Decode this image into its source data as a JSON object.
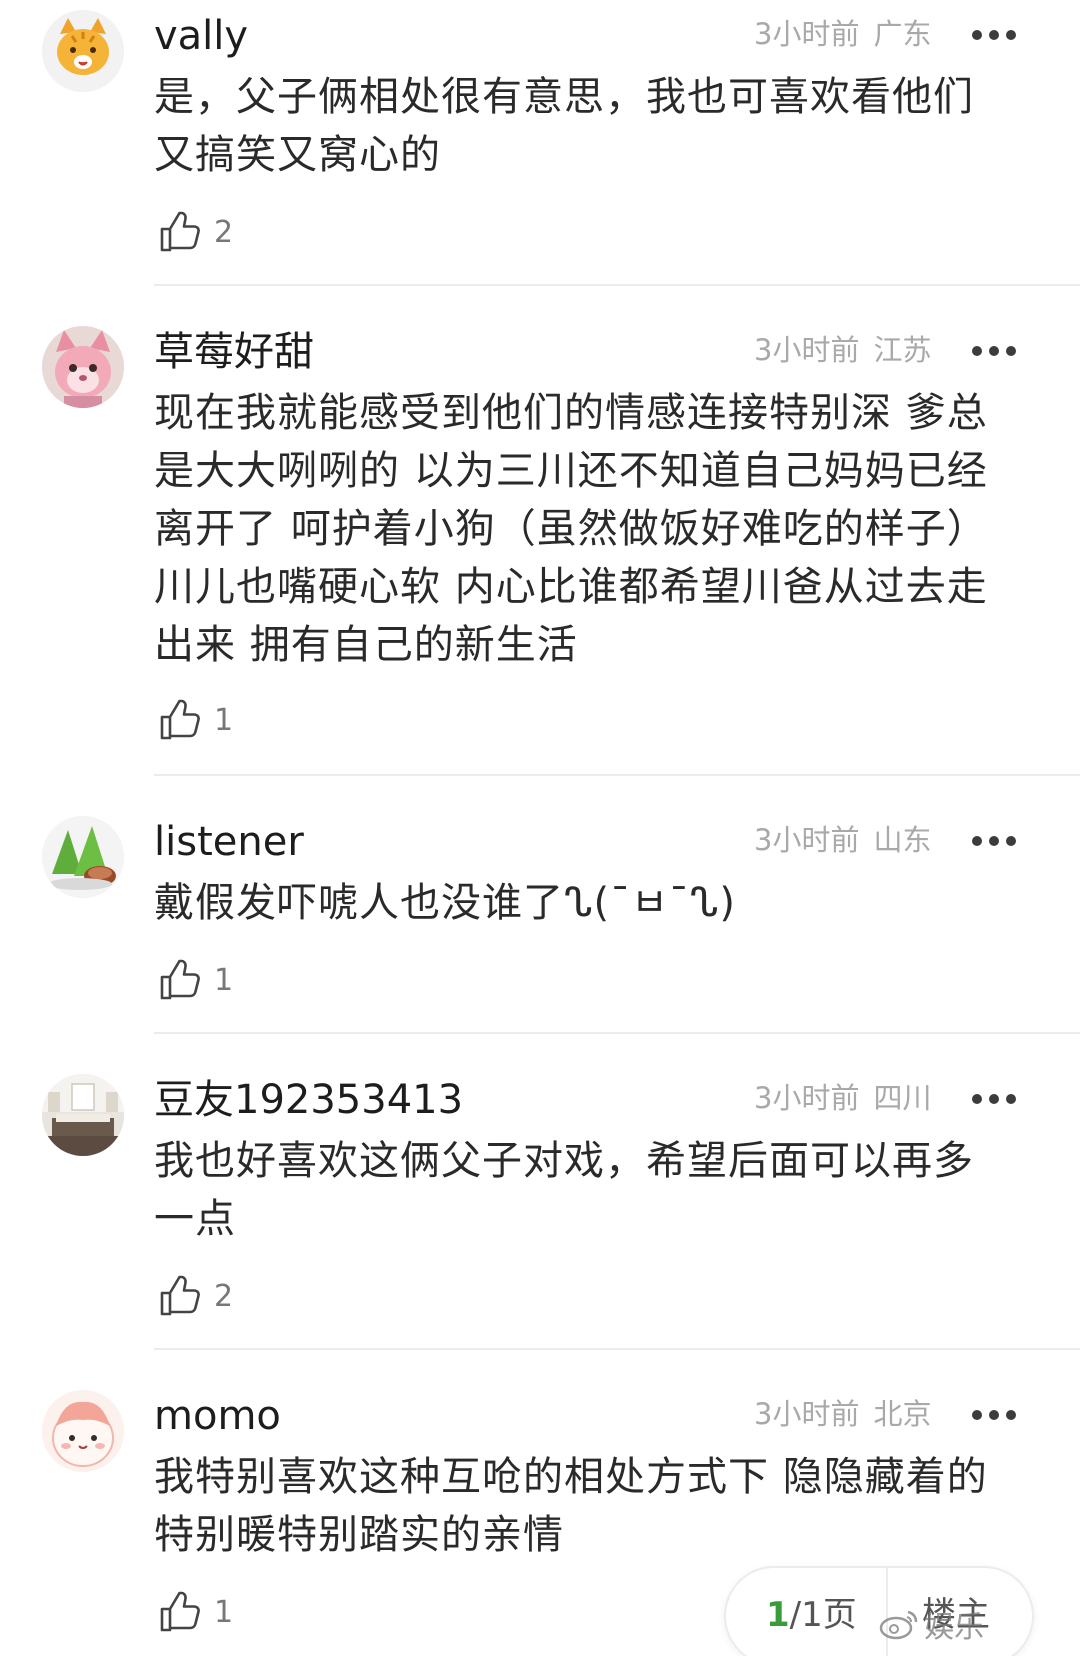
{
  "comments": [
    {
      "username": "vally",
      "time": "3小时前",
      "location": "广东",
      "text": "是，父子俩相处很有意思，我也可喜欢看他们\n又搞笑又窝心的",
      "likes": "2"
    },
    {
      "username": "草莓好甜",
      "time": "3小时前",
      "location": "江苏",
      "text": "现在我就能感受到他们的情感连接特别深 爹总\n是大大咧咧的 以为三川还不知道自己妈妈已经\n离开了 呵护着小狗（虽然做饭好难吃的样子）\n川儿也嘴硬心软 内心比谁都希望川爸从过去走\n出来 拥有自己的新生活",
      "likes": "1"
    },
    {
      "username": "listener",
      "time": "3小时前",
      "location": "山东",
      "text": "戴假发吓唬人也没谁了ᔐ(¯ㅂ¯ᔐ)",
      "likes": "1"
    },
    {
      "username": "豆友192353413",
      "time": "3小时前",
      "location": "四川",
      "text": "我也好喜欢这俩父子对戏，希望后面可以再多\n一点",
      "likes": "2"
    },
    {
      "username": "momo",
      "time": "3小时前",
      "location": "北京",
      "text": "我特别喜欢这种互呛的相处方式下 隐隐藏着的\n特别暖特别踏实的亲情",
      "likes": "1"
    }
  ],
  "pager": {
    "current": "1",
    "total_text": "/1页",
    "floor_label": "楼主"
  },
  "watermark": "娱乐"
}
